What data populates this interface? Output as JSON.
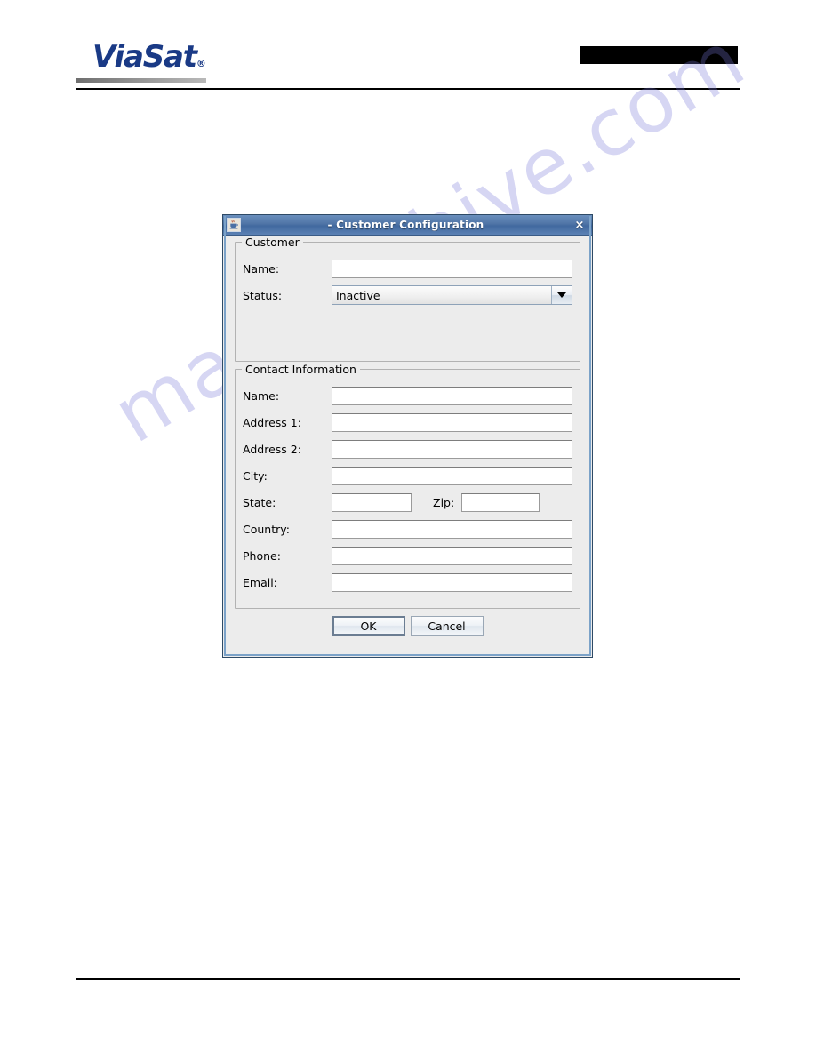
{
  "page": {
    "logo": {
      "text": "ViaSat",
      "registered_mark": "®",
      "color": "#1a3a86"
    },
    "redaction_bar": {
      "label": "redacted-header-block"
    },
    "watermark": {
      "text": "manualshive.com"
    }
  },
  "dialog": {
    "title": "- Customer Configuration",
    "icon": "java-coffee-cup-icon",
    "close_label": "×",
    "customer_group": {
      "title": "Customer",
      "fields": [
        {
          "label": "Name:",
          "type": "text",
          "value": "",
          "placeholder": ""
        },
        {
          "label": "Status:",
          "type": "combo",
          "value": "Inactive"
        }
      ]
    },
    "contact_group": {
      "title": "Contact Information",
      "fields": [
        {
          "label": "Name:",
          "type": "text",
          "value": "",
          "placeholder": ""
        },
        {
          "label": "Address 1:",
          "type": "text",
          "value": "",
          "placeholder": ""
        },
        {
          "label": "Address 2:",
          "type": "text",
          "value": "",
          "placeholder": ""
        },
        {
          "label": "City:",
          "type": "text",
          "value": "",
          "placeholder": ""
        },
        {
          "label": "State:",
          "type": "text",
          "value": "",
          "placeholder": ""
        },
        {
          "label": "Zip:",
          "type": "text",
          "value": "",
          "placeholder": ""
        },
        {
          "label": "Country:",
          "type": "text",
          "value": "",
          "placeholder": ""
        },
        {
          "label": "Phone:",
          "type": "text",
          "value": "",
          "placeholder": ""
        },
        {
          "label": "Email:",
          "type": "text",
          "value": "",
          "placeholder": ""
        }
      ]
    },
    "buttons": {
      "ok_label": "OK",
      "cancel_label": "Cancel"
    },
    "colors": {
      "titlebar_blue": "#4f74a6",
      "dialog_face": "#ececec",
      "border": "#2e4a66"
    }
  }
}
